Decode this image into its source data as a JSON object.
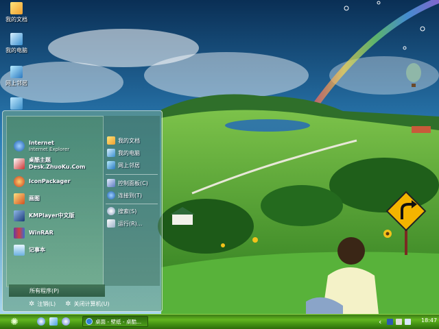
{
  "desktop": {
    "icons": [
      {
        "label": "我的文档"
      },
      {
        "label": "我的电脑"
      },
      {
        "label": "网上邻居"
      }
    ]
  },
  "start_menu": {
    "pinned": [
      {
        "name": "Internet",
        "sub": "Internet Explorer"
      },
      {
        "name": "桌酷主题Desk.ZhuoKu.Com"
      },
      {
        "name": "IconPackager"
      },
      {
        "name": "画图"
      },
      {
        "name": "KMPlayer中文版"
      },
      {
        "name": "WinRAR"
      },
      {
        "name": "记事本"
      }
    ],
    "all_programs": "所有程序(P)",
    "places": [
      {
        "label": "我的文档"
      },
      {
        "label": "我的电脑"
      },
      {
        "label": "网上邻居"
      },
      {
        "label": "控制面板(C)"
      },
      {
        "label": "连接到(T)"
      },
      {
        "label": "搜索(S)"
      },
      {
        "label": "运行(R)..."
      }
    ],
    "logoff": "注销(L)",
    "shutdown": "关闭计算机(U)"
  },
  "taskbar": {
    "task_label": "桌面 - 壁纸 - 桌酷...",
    "clock": "18:47",
    "tray_arrow": "‹"
  },
  "colors": {
    "taskbar_green": "#4f9c18",
    "sky_top": "#0d3b66",
    "grass": "#3f9a2c"
  }
}
